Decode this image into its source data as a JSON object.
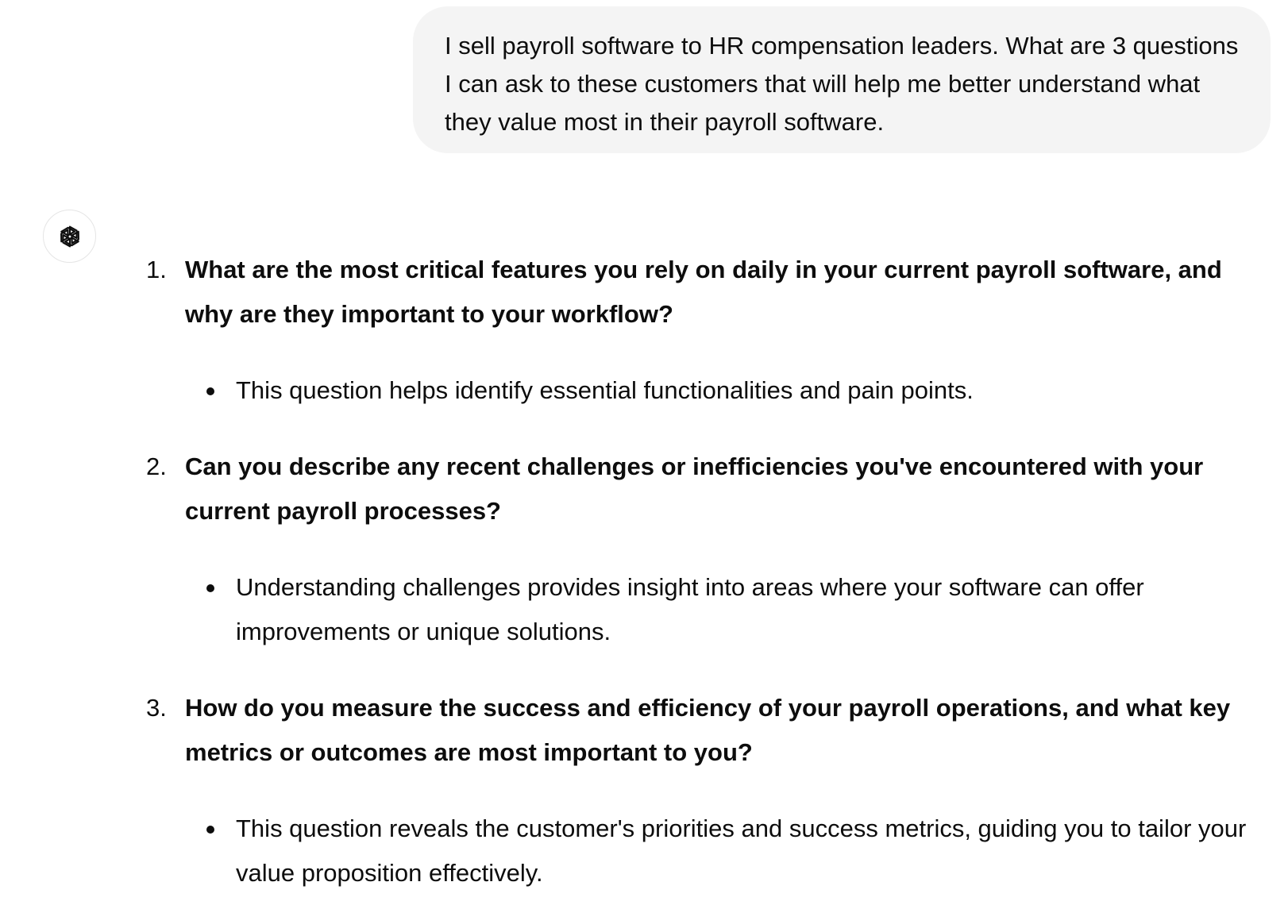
{
  "user_message": {
    "text": "I sell payroll software to HR compensation leaders. What are 3 questions I can ask to these customers that will help me better understand what they value most in their payroll software."
  },
  "assistant": {
    "avatar_icon": "openai-logo-icon",
    "items": [
      {
        "number": "1.",
        "question": "What are the most critical features you rely on daily in your current payroll software, and why are they important to your workflow?",
        "bullet": "This question helps identify essential functionalities and pain points."
      },
      {
        "number": "2.",
        "question": "Can you describe any recent challenges or inefficiencies you've encountered with your current payroll processes?",
        "bullet": "Understanding challenges provides insight into areas where your software can offer improvements or unique solutions."
      },
      {
        "number": "3.",
        "question": "How do you measure the success and efficiency of your payroll operations, and what key metrics or outcomes are most important to you?",
        "bullet": "This question reveals the customer's priorities and success metrics, guiding you to tailor your value proposition effectively."
      }
    ]
  },
  "colors": {
    "bubble_bg": "#f4f4f4",
    "text": "#0d0d0d",
    "avatar_border": "#e5e5e5"
  }
}
